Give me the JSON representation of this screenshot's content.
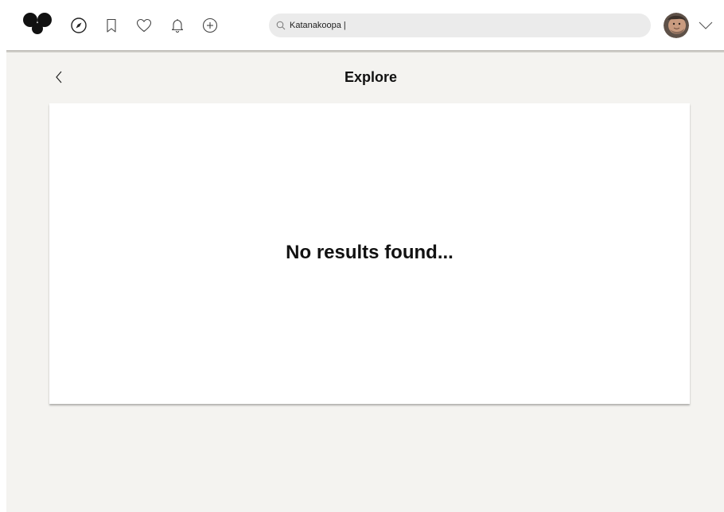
{
  "header": {
    "nav_icons": [
      "compass-icon",
      "bookmark-icon",
      "heart-icon",
      "bell-icon",
      "plus-circle-icon"
    ],
    "search": {
      "value": "Katanakoopa |",
      "placeholder": ""
    }
  },
  "main": {
    "title": "Explore",
    "empty_message": "No results found..."
  },
  "colors": {
    "page_background": "#f4f3f0",
    "card_background": "#ffffff",
    "search_background": "#ebebeb",
    "text": "#111111"
  }
}
